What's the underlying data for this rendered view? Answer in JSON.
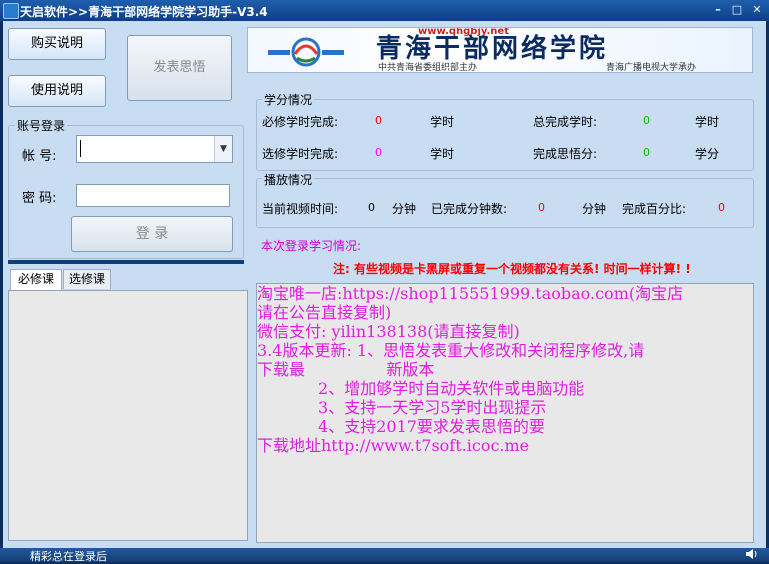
{
  "window": {
    "title": "天启软件>>青海干部网络学院学习助手-V3.4",
    "min": "–",
    "max": "□",
    "close": "✕"
  },
  "buttons": {
    "buy": "购买说明",
    "usage": "使用说明",
    "post_insight": "发表思悟",
    "login": "登 录"
  },
  "banner": {
    "site_url": "www.qhgbjy.net",
    "title": "青海干部网络学院",
    "org_left": "中共青海省委组织部主办",
    "org_right": "青海广播电视大学承办"
  },
  "account": {
    "group_title": "账号登录",
    "username_label": "帐  号:",
    "password_label": "密  码:",
    "username_value": "",
    "password_value": ""
  },
  "study": {
    "group_title": "学分情况",
    "required_label": "必修学时完成:",
    "required_value": "0",
    "required_unit": "学时",
    "total_label": "总完成学时:",
    "total_value": "0",
    "total_unit": "学时",
    "elective_label": "选修学时完成:",
    "elective_value": "0",
    "elective_unit": "学时",
    "insight_label": "完成思悟分:",
    "insight_value": "0",
    "insight_unit": "学分"
  },
  "playback": {
    "group_title": "播放情况",
    "current_label": "当前视频时间:",
    "current_value": "0",
    "current_unit": "分钟",
    "done_label": "已完成分钟数:",
    "done_value": "0",
    "done_unit": "分钟",
    "percent_label": "完成百分比:",
    "percent_value": "0"
  },
  "session_title": "本次登录学习情况:",
  "warning": "注: 有些视频是卡黑屏或重复一个视频都没有关系! 时间一样计算! !",
  "tabs": [
    {
      "label": "必修课"
    },
    {
      "label": "选修课"
    }
  ],
  "notice_lines": [
    "淘宝唯一店:https://shop115551999.taobao.com(淘宝店",
    "请在公告直接复制)",
    "微信支付: yilin138138(请直接复制)",
    "",
    "",
    "3.4版本更新: 1、思悟发表重大修改和关闭程序修改,请",
    "下载最                新版本",
    "            2、增加够学时自动关软件或电脑功能",
    "            3、支持一天学习5学时出现提示",
    "            4、支持2017要求发表思悟的要",
    "下载地址http://www.t7soft.icoc.me"
  ],
  "status": {
    "text": "精彩总在登录后",
    "icon": "speaker-icon"
  },
  "colors": {
    "title_bg": "#1a5aa8",
    "client_bg": "#c8dcf2",
    "notice_text": "#e020e0",
    "value_red": "#ff0000",
    "value_green": "#00c000",
    "session_title": "#d000d0",
    "warning_red": "#ff0000"
  }
}
